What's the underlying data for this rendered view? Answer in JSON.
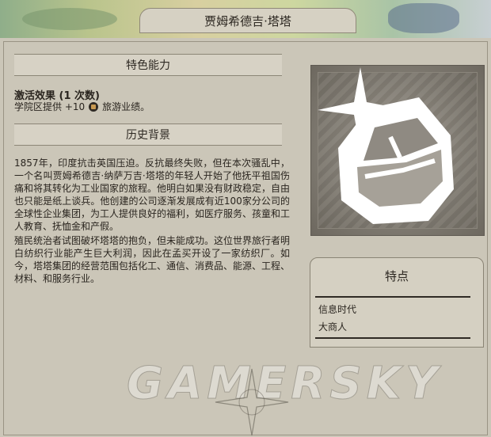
{
  "window": {
    "title": "贾姆希德吉·塔塔"
  },
  "ability": {
    "section_title": "特色能力",
    "name": "激活效果 (1 次数)",
    "desc_prefix": "学院区提供 +10",
    "desc_suffix": "旅游业绩。",
    "icon": "tourism-icon"
  },
  "history": {
    "section_title": "历史背景",
    "paragraphs": [
      "1857年，印度抗击英国压迫。反抗最终失败，但在本次骚乱中，一个名叫贾姆希德吉·纳萨万吉·塔塔的年轻人开始了他抚平祖国伤痛和将其转化为工业国家的旅程。他明白如果没有财政稳定，自由也只能是纸上谈兵。他创建的公司逐渐发展成有近100家分公司的全球性企业集团，为工人提供良好的福利，如医疗服务、孩童和工人教育、抚恤金和产假。",
      "殖民统治者试图破坏塔塔的抱负，但未能成功。这位世界旅行者明白纺织行业能产生巨大利润，因此在孟买开设了一家纺织厂。如今，塔塔集团的经营范围包括化工、通信、消费品、能源、工程、材料、和服务行业。"
    ]
  },
  "portrait": {
    "icon": "great-person-gem-icon"
  },
  "traits": {
    "title": "特点",
    "items": [
      "信息时代",
      "大商人"
    ]
  },
  "watermark": {
    "text": "GAMERSKY",
    "icon": "compass-rose-icon"
  }
}
